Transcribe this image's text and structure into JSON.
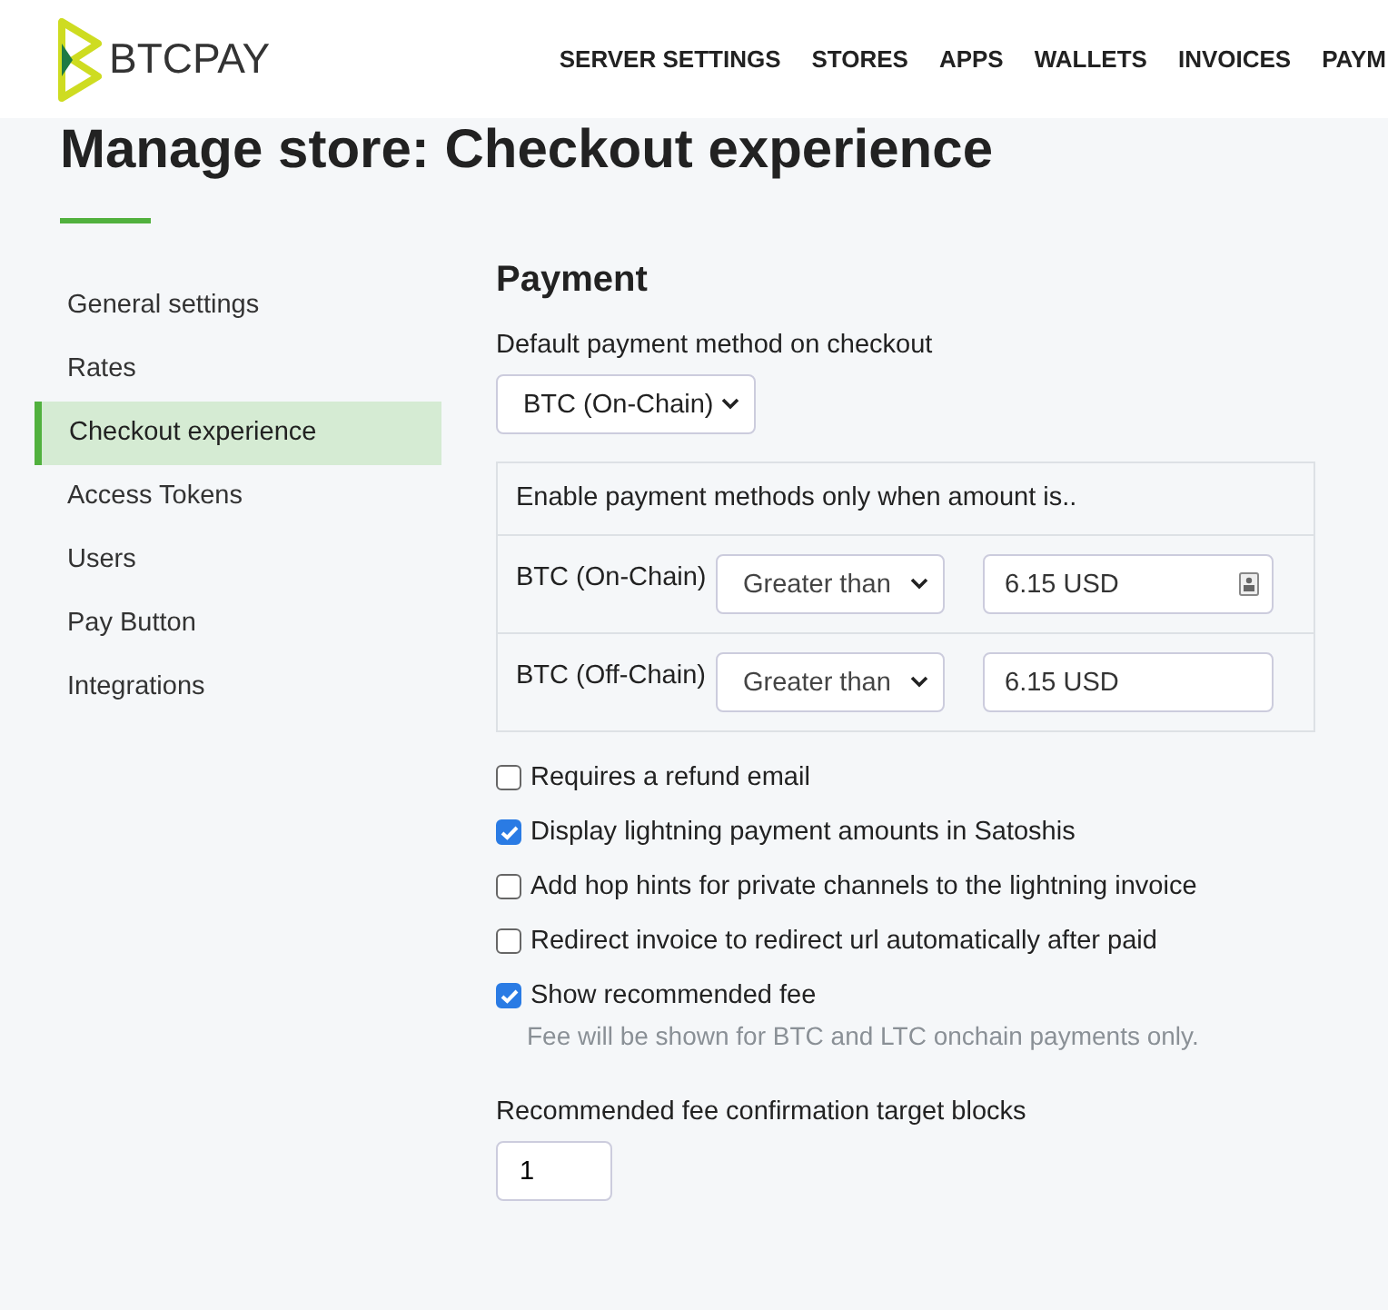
{
  "header": {
    "logo_text": "BTCPAY",
    "nav": [
      {
        "label": "SERVER SETTINGS"
      },
      {
        "label": "STORES"
      },
      {
        "label": "APPS"
      },
      {
        "label": "WALLETS"
      },
      {
        "label": "INVOICES"
      },
      {
        "label": "PAYM"
      }
    ]
  },
  "page_title": "Manage store: Checkout experience",
  "sidebar": {
    "items": [
      {
        "label": "General settings",
        "selected": false
      },
      {
        "label": "Rates",
        "selected": false
      },
      {
        "label": "Checkout experience",
        "selected": true
      },
      {
        "label": "Access Tokens",
        "selected": false
      },
      {
        "label": "Users",
        "selected": false
      },
      {
        "label": "Pay Button",
        "selected": false
      },
      {
        "label": "Integrations",
        "selected": false
      }
    ]
  },
  "payment": {
    "heading": "Payment",
    "default_method_label": "Default payment method on checkout",
    "default_method_value": "BTC (On-Chain)",
    "criteria": {
      "heading": "Enable payment methods only when amount is..",
      "rows": [
        {
          "method": "BTC (On-Chain)",
          "operator": "Greater than",
          "amount": "6.15 USD",
          "autofill_icon": true
        },
        {
          "method": "BTC (Off-Chain)",
          "operator": "Greater than",
          "amount": "6.15 USD",
          "autofill_icon": false
        }
      ]
    },
    "options": [
      {
        "label": "Requires a refund email",
        "checked": false
      },
      {
        "label": "Display lightning payment amounts in Satoshis",
        "checked": true
      },
      {
        "label": "Add hop hints for private channels to the lightning invoice",
        "checked": false
      },
      {
        "label": "Redirect invoice to redirect url automatically after paid",
        "checked": false
      },
      {
        "label": "Show recommended fee",
        "checked": true,
        "hint": "Fee will be shown for BTC and LTC onchain payments only."
      }
    ],
    "target_blocks_label": "Recommended fee confirmation target blocks",
    "target_blocks_value": "1"
  }
}
